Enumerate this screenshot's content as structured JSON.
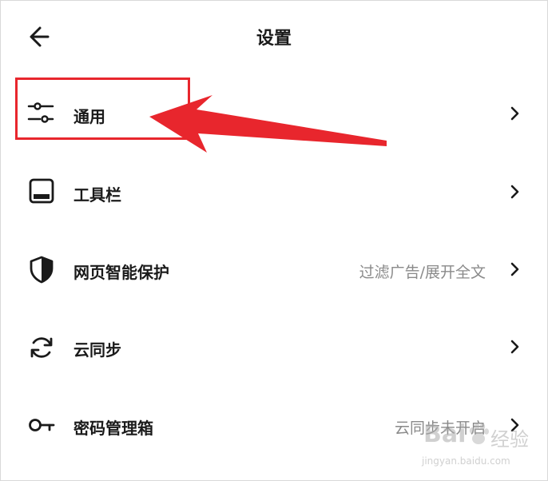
{
  "header": {
    "title": "设置",
    "back_icon": "arrow-left-icon"
  },
  "settings": [
    {
      "id": "general",
      "label": "通用",
      "icon": "sliders-icon",
      "value": ""
    },
    {
      "id": "toolbar",
      "label": "工具栏",
      "icon": "toolbar-icon",
      "value": ""
    },
    {
      "id": "protection",
      "label": "网页智能保护",
      "icon": "shield-icon",
      "value": "过滤广告/展开全文"
    },
    {
      "id": "sync",
      "label": "云同步",
      "icon": "sync-icon",
      "value": ""
    },
    {
      "id": "password",
      "label": "密码管理箱",
      "icon": "key-icon",
      "value": "云同步未开启"
    }
  ],
  "annotation": {
    "color": "#e8262d",
    "highlight_target": "general"
  },
  "watermark": {
    "brand": "Bai",
    "brand_suffix": "经验",
    "url": "jingyan.baidu.com"
  }
}
